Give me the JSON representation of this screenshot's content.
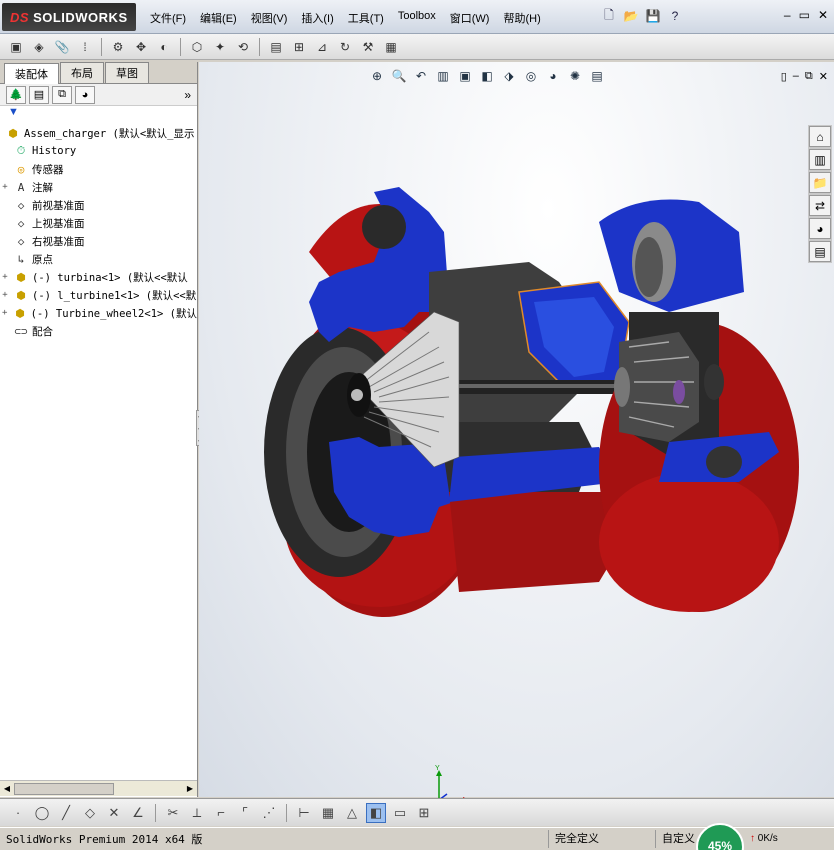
{
  "app": {
    "logo": "SOLIDWORKS",
    "logo_prefix": "DS"
  },
  "menu": [
    "文件(F)",
    "编辑(E)",
    "视图(V)",
    "插入(I)",
    "工具(T)",
    "Toolbox",
    "窗口(W)",
    "帮助(H)"
  ],
  "left_tabs": [
    "装配体",
    "布局",
    "草图"
  ],
  "tree": [
    {
      "label": "Assem_charger  (默认<默认_显示",
      "icon": "assembly-icon",
      "expander": ""
    },
    {
      "label": "History",
      "icon": "history-icon",
      "expander": ""
    },
    {
      "label": "传感器",
      "icon": "sensor-icon",
      "expander": ""
    },
    {
      "label": "注解",
      "icon": "annotation-icon",
      "expander": "+"
    },
    {
      "label": "前视基准面",
      "icon": "plane-icon",
      "expander": ""
    },
    {
      "label": "上视基准面",
      "icon": "plane-icon",
      "expander": ""
    },
    {
      "label": "右视基准面",
      "icon": "plane-icon",
      "expander": ""
    },
    {
      "label": "原点",
      "icon": "origin-icon",
      "expander": ""
    },
    {
      "label": "(-) turbina<1> (默认<<默认",
      "icon": "part-icon",
      "expander": "+"
    },
    {
      "label": "(-) l_turbine1<1> (默认<<默",
      "icon": "part-icon",
      "expander": "+"
    },
    {
      "label": "(-) Turbine_wheel2<1> (默认",
      "icon": "part-icon",
      "expander": "+"
    },
    {
      "label": "配合",
      "icon": "mates-icon",
      "expander": ""
    }
  ],
  "status": {
    "left": "SolidWorks Premium 2014 x64 版",
    "definition": "完全定义",
    "custom": "自定义",
    "progress_percent": "45%",
    "net_speed": "0K/s"
  },
  "axes": {
    "x": "X",
    "y": "Y"
  },
  "colors": {
    "housing_red": "#b81414",
    "cut_blue": "#1c34c8",
    "metal_gray": "#3a3a3a"
  }
}
